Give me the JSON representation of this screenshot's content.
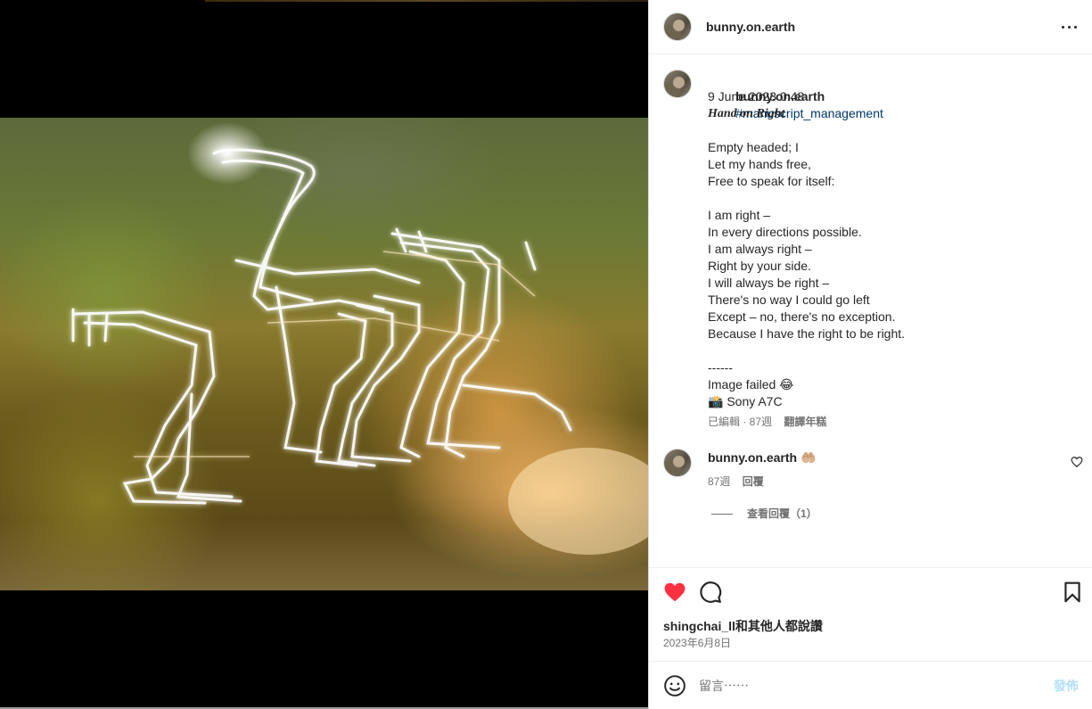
{
  "post": {
    "username": "bunny.on.earth",
    "hashtag": "#manuscript_management",
    "timestamp": "9 June 2023 0:48",
    "poem_title": "Hand on Right",
    "lines": [
      "",
      "Empty headed; I",
      "Let my hands free,",
      "Free to speak for itself:",
      "",
      "I am right –",
      "In every directions possible.",
      "I am always right –",
      "Right by your side.",
      "I will always be right –",
      "There's no way I could go left",
      "Except – no, there's no exception.",
      "Because I have the right to be right.",
      "",
      "------",
      "Image failed 😂",
      "📸 Sony A7C"
    ],
    "edited_label": "已編輯 · 87週",
    "translate_label": "翻譯年糕"
  },
  "comment": {
    "username": "bunny.on.earth",
    "text": "🤲🏼",
    "age": "87週",
    "reply_label": "回覆",
    "view_replies_label": "查看回覆（1）"
  },
  "likes": {
    "first_user": "shingchai_ll",
    "rest": "和其他人都說讚"
  },
  "post_date": "2023年6月8日",
  "comment_box": {
    "placeholder": "留言⋯⋯",
    "post_label": "發佈"
  },
  "icons": {
    "more": "more-icon",
    "like": "heart-icon",
    "comment": "comment-icon",
    "save": "bookmark-icon",
    "emoji": "emoji-icon",
    "comment_like": "heart-outline-icon"
  },
  "colors": {
    "like_red": "#ff3040",
    "hashtag_blue": "#00376b",
    "post_button_disabled": "#b2dffc",
    "secondary_text": "#737373"
  }
}
